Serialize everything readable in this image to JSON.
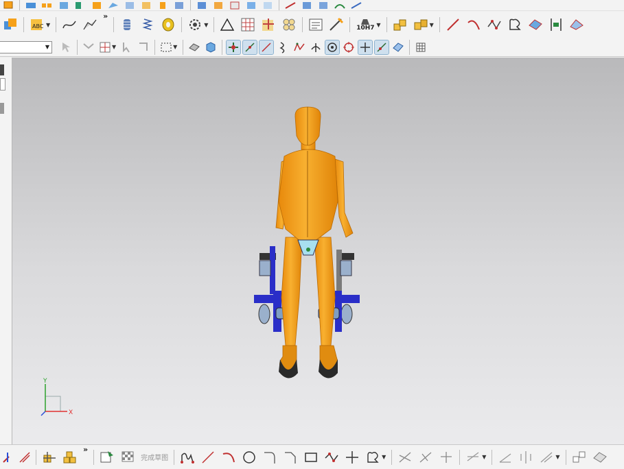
{
  "toolbars": {
    "sketch_combo_value": "",
    "bottom": {
      "finish_sketch_label": "完成草图"
    },
    "hole_tolerance_label": "10H7"
  },
  "viewport": {
    "triad_axes": {
      "x_label": "X",
      "y_label": "Y"
    }
  },
  "colors": {
    "viewport_top": "#b9b9bb",
    "viewport_bottom": "#ebebed",
    "mannequin": "#f6a11a",
    "exoskeleton_frame": "#2a2ec8",
    "axis_x": "#e03030",
    "axis_y": "#2aa02a",
    "axis_z": "#2a4fd8"
  },
  "icons": {
    "row1": [
      "cube-icon",
      "block-icon",
      "array-icon",
      "extrude-icon",
      "pipe-icon",
      "box-icon",
      "surface-icon",
      "chamfer-icon",
      "book-icon",
      "cylinder-icon",
      "shell-icon",
      "solid-icon",
      "dome-icon",
      "edge-icon",
      "intersect-icon",
      "cut-icon",
      "ruler-icon",
      "curve-icon",
      "drape-icon",
      "shape-icon",
      "rotate-icon"
    ],
    "row2": [
      "assembly-icon",
      "text-icon",
      "spline-icon",
      "freeform-icon",
      "thread-icon",
      "spring-icon",
      "coil-icon",
      "gear-icon",
      "triangle-icon",
      "grid-icon",
      "sketch-plus-icon",
      "pattern-icon",
      "note-icon",
      "dimension-icon",
      "hole-icon",
      "parts-icon",
      "constraint-icon",
      "line-icon",
      "arc-icon",
      "polyline-icon",
      "heart-icon",
      "surface-patch-icon",
      "section-icon",
      "measure-icon"
    ],
    "row3": [
      "pointer-icon",
      "filter-icon",
      "snap-grid-icon",
      "quick-pick-icon",
      "select-box-icon",
      "view-solid-icon",
      "view-cube-icon",
      "snap-endpoint-icon",
      "snap-midpoint-icon",
      "snap-line-icon",
      "snap-curve-icon",
      "snap-control-icon",
      "snap-perp-icon",
      "snap-center-icon",
      "snap-tangent-icon",
      "snap-intersect-icon",
      "snap-on-curve-icon",
      "snap-face-icon",
      "table-icon"
    ],
    "row4": [
      "axis-icon",
      "constraint-infer-icon",
      "assembly-load-icon",
      "components-icon",
      "sketch-view-icon",
      "finish-flag-icon",
      "profile-icon",
      "sketch-line-icon",
      "sketch-arc-icon",
      "sketch-circle-icon",
      "fillet-icon",
      "chamfer-sketch-icon",
      "rectangle-icon",
      "polygon-icon",
      "point-icon",
      "offset-icon",
      "trim-icon",
      "extend-icon",
      "corner-icon",
      "dimension-sketch-icon",
      "angle-icon",
      "perpendicular-icon",
      "parallel-icon",
      "misc-icon",
      "display-icon"
    ]
  }
}
